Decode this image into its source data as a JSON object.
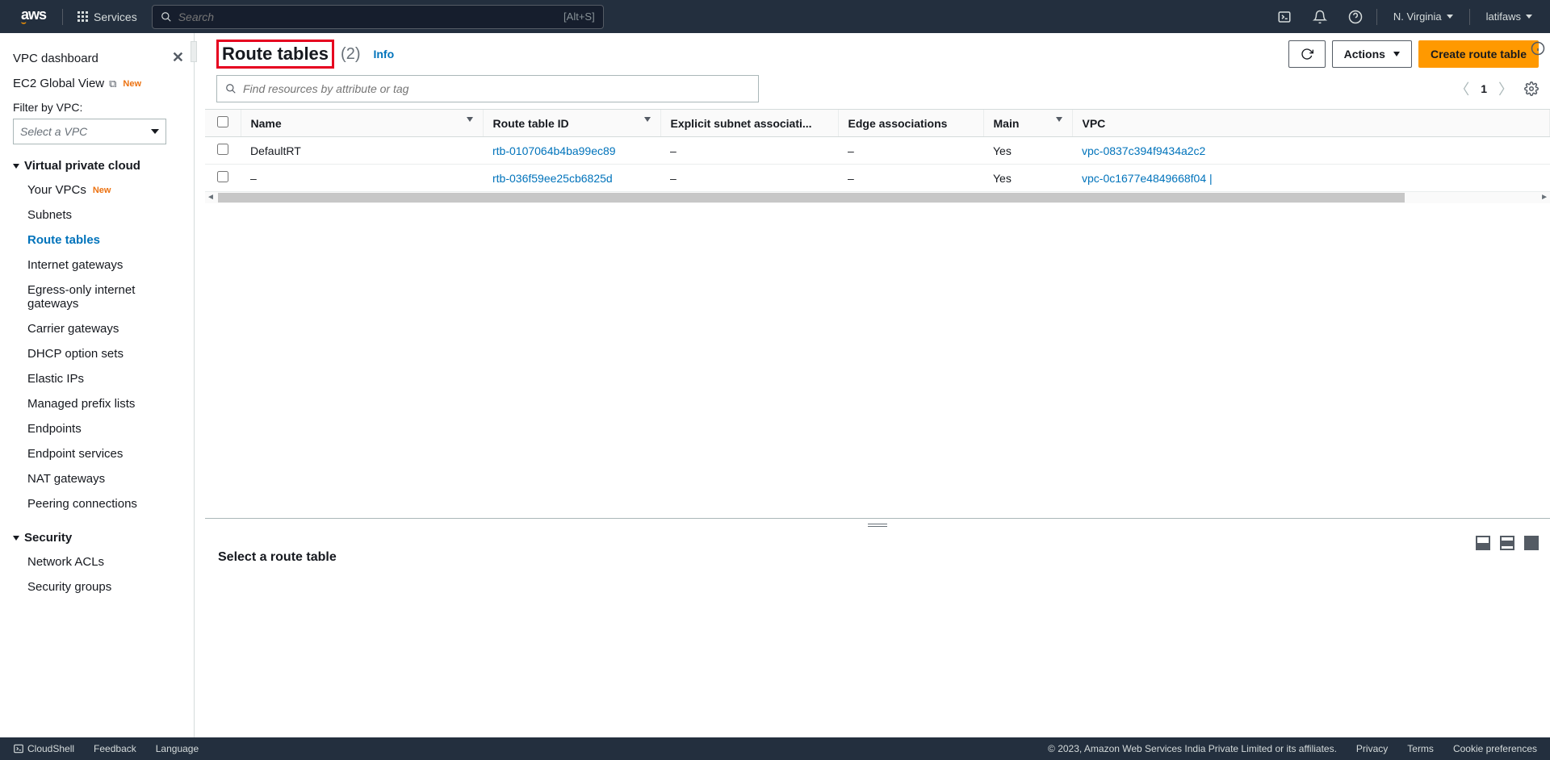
{
  "topnav": {
    "services_label": "Services",
    "search_placeholder": "Search",
    "search_shortcut": "[Alt+S]",
    "region": "N. Virginia",
    "user": "latifaws"
  },
  "sidebar": {
    "dashboard": "VPC dashboard",
    "ec2_global": "EC2 Global View",
    "ec2_new": "New",
    "filter_label": "Filter by VPC:",
    "vpc_placeholder": "Select a VPC",
    "section_vpc": "Virtual private cloud",
    "vpc_items": {
      "your_vpcs": "Your VPCs",
      "your_vpcs_new": "New",
      "subnets": "Subnets",
      "route_tables": "Route tables",
      "igw": "Internet gateways",
      "egress": "Egress-only internet gateways",
      "carrier": "Carrier gateways",
      "dhcp": "DHCP option sets",
      "eips": "Elastic IPs",
      "prefix": "Managed prefix lists",
      "endpoints": "Endpoints",
      "endpoint_services": "Endpoint services",
      "nat": "NAT gateways",
      "peering": "Peering connections"
    },
    "section_security": "Security",
    "security_items": {
      "nacl": "Network ACLs",
      "sg": "Security groups"
    }
  },
  "header": {
    "title": "Route tables",
    "count": "(2)",
    "info": "Info",
    "actions": "Actions",
    "create": "Create route table"
  },
  "table_search_placeholder": "Find resources by attribute or tag",
  "pager_num": "1",
  "columns": {
    "name": "Name",
    "rtid": "Route table ID",
    "explicit": "Explicit subnet associati...",
    "edge": "Edge associations",
    "main": "Main",
    "vpc": "VPC"
  },
  "rows": [
    {
      "name": "DefaultRT",
      "rtid": "rtb-0107064b4ba99ec89",
      "explicit": "–",
      "edge": "–",
      "main": "Yes",
      "vpc": "vpc-0837c394f9434a2c2"
    },
    {
      "name": "–",
      "rtid": "rtb-036f59ee25cb6825d",
      "explicit": "–",
      "edge": "–",
      "main": "Yes",
      "vpc": "vpc-0c1677e4849668f04 |"
    }
  ],
  "bottom": {
    "title": "Select a route table"
  },
  "footer": {
    "cloudshell": "CloudShell",
    "feedback": "Feedback",
    "language": "Language",
    "copyright": "© 2023, Amazon Web Services India Private Limited or its affiliates.",
    "privacy": "Privacy",
    "terms": "Terms",
    "cookie": "Cookie preferences"
  }
}
